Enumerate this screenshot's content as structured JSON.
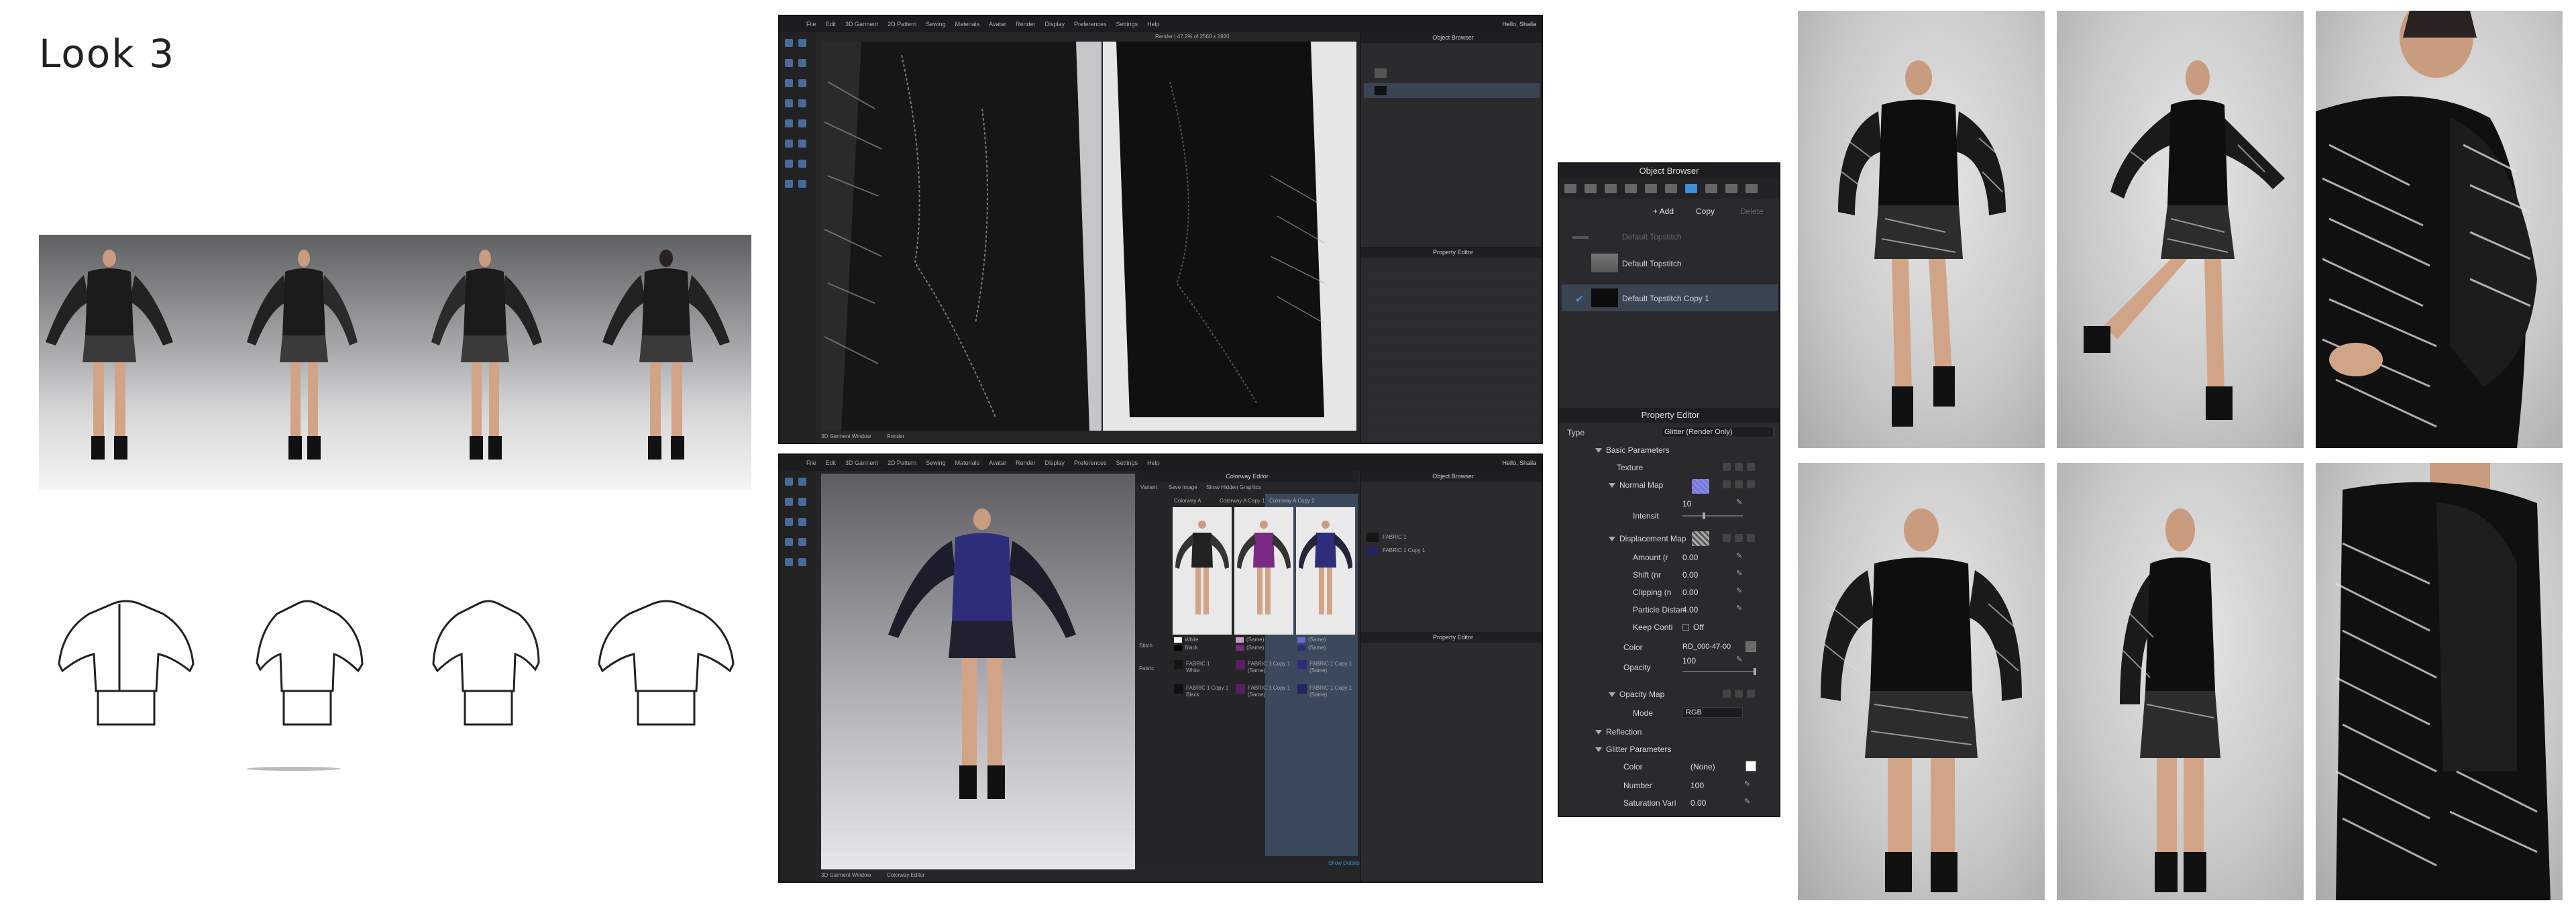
{
  "page_title": "Look 3",
  "window_top": {
    "menu": [
      "File",
      "Edit",
      "3D Garment",
      "2D Pattern",
      "Sewing",
      "Materials",
      "Avatar",
      "Render",
      "Display",
      "Preferences",
      "Settings",
      "Help"
    ],
    "user": "Hello, Shaila",
    "viewport_header": "Render | 47.2% of 2560 x 1920",
    "panel_header": "Object Browser",
    "prop_header": "Property Editor",
    "bottom_tabs": [
      "3D Garment Window",
      "Render"
    ]
  },
  "window_bottom": {
    "menu": [
      "File",
      "Edit",
      "3D Garment",
      "2D Pattern",
      "Sewing",
      "Materials",
      "Avatar",
      "Render",
      "Display",
      "Preferences",
      "Settings",
      "Help"
    ],
    "user": "Hello, Shaila",
    "editor_header": "Colorway Editor",
    "toolbar": [
      "Variant",
      "Save Image",
      "Show Hidden Graphics"
    ],
    "colorways": [
      "Colorway A",
      "Colorway A Copy 1",
      "Colorway A Copy 2"
    ],
    "rows": [
      {
        "group": "Stitch",
        "cells": [
          [
            "White",
            "Black"
          ],
          [
            "(Same)",
            "(Same)"
          ],
          [
            "(Same)",
            "(Same)"
          ]
        ]
      },
      {
        "group": "Fabric",
        "cells": [
          [
            "FABRIC 1",
            "White"
          ],
          [
            "FABRIC 1 Copy 1",
            "(Same)"
          ],
          [
            "FABRIC 1 Copy 1",
            "(Same)"
          ]
        ]
      },
      {
        "group": "",
        "cells": [
          [
            "FABRIC 1 Copy 1",
            "Black"
          ],
          [
            "FABRIC 1 Copy 1",
            "(Same)"
          ],
          [
            "FABRIC 1 Copy 1",
            "(Same)"
          ]
        ]
      }
    ],
    "panel_header": "Object Browser",
    "prop_header": "Property Editor",
    "fabric_items": [
      "FABRIC 1",
      "FABRIC 1 Copy 1"
    ],
    "bottom_tabs": [
      "3D Garment Window",
      "Colorway Editor"
    ],
    "footer_link": "Show Details"
  },
  "object_browser": {
    "title": "Object Browser",
    "add_label": "+ Add",
    "copy_label": "Copy",
    "other_label": "Delete",
    "items": [
      {
        "label": "Default Topstitch",
        "dim": true
      },
      {
        "label": "Default Topstitch"
      },
      {
        "label": "Default Topstitch Copy 1",
        "selected": true
      }
    ]
  },
  "property_editor": {
    "title": "Property Editor",
    "type_label": "Type",
    "type_value": "Glitter (Render Only)",
    "basic_parameters": "Basic Parameters",
    "texture_label": "Texture",
    "normal_map": "Normal Map",
    "normal_value": "10",
    "intensity_label": "Intensit",
    "displacement_map": "Displacement Map",
    "amount_label": "Amount (r",
    "amount_value": "0.00",
    "shift_label": "Shift (nr",
    "shift_value": "0.00",
    "clipping_label": "Clipping (n",
    "clipping_value": "0.00",
    "particle_label": "Particle Distan",
    "particle_value": "4.00",
    "keep_label": "Keep Conti",
    "keep_value": "Off",
    "color_label": "Color",
    "color_value": "RD_000-47-00",
    "opacity_label": "Opacity",
    "opacity_value": "100",
    "opacity_map": "Opacity Map",
    "mode_label": "Mode",
    "mode_value": "RGB",
    "reflection": "Reflection",
    "glitter_parameters": "Glitter Parameters",
    "gcolor_label": "Color",
    "gcolor_value": "(None)",
    "number_label": "Number",
    "number_value": "100",
    "saturation_label": "Saturation Vari",
    "saturation_value": "0.00"
  },
  "colors": {
    "ui_dark": "#262629",
    "selected_row": "#3b4452",
    "accent_blue": "#3c8fd8",
    "purple_colorway": "#7a2a85",
    "navy_colorway": "#2d2d7a"
  }
}
